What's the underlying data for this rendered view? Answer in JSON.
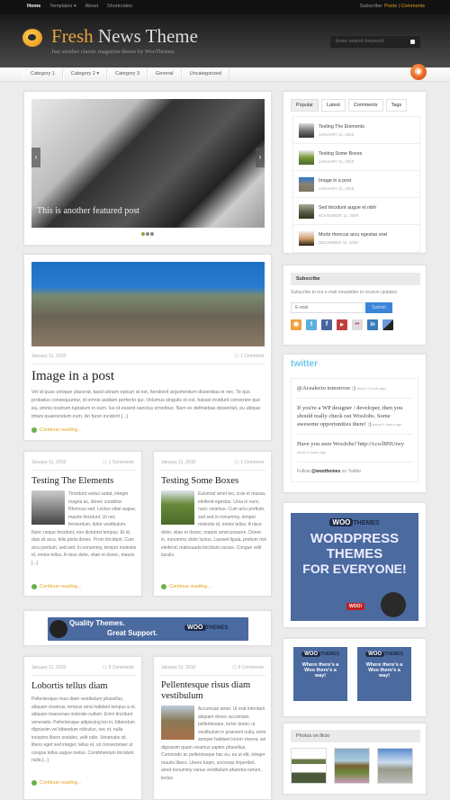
{
  "topnav": {
    "items": [
      {
        "label": "Home",
        "active": true
      },
      {
        "label": "Templates ▾",
        "active": false
      },
      {
        "label": "About",
        "active": false
      },
      {
        "label": "Shortcodes",
        "active": false
      }
    ],
    "subscribe_label": "Subscribe:",
    "posts_link": "Posts",
    "separator": "|",
    "comments_link": "Comments"
  },
  "header": {
    "title_highlight": "Fresh",
    "title_rest": " News Theme",
    "tagline": "Just another classic magazine theme by WooThemes",
    "search_placeholder": "Enter search keyword"
  },
  "categories": [
    "Category 1",
    "Category 2 ▾",
    "Category 3",
    "General",
    "Uncategorized"
  ],
  "slider": {
    "caption": "This is another featured post",
    "prev": "‹",
    "next": "›",
    "slides": 3,
    "active_slide": 1
  },
  "featured_post": {
    "date": "January 11, 2010",
    "comments": "1 Comment",
    "title": "Image in a post",
    "excerpt": "Vel id quas utroque placerat, kasd utinam epicuri at est, hendrerit argumentum dissentias ei nec. Te qus probatus consequuntur, id omnis audiam perfecto qui. Volumus singulis et est, fuisset invidunt convenire quo ea, omnis nostrum luptatum in eum. Ius id essent sanctus erroribus. Nam ex definiebas dissentiet, eu ubique tritani quaerendum eum. An facer inciderit [...]",
    "continue": "Continue reading..."
  },
  "posts": [
    {
      "date": "January 11, 2010",
      "comments": "1 Comments",
      "title": "Testing The Elements",
      "excerpt": "Tincidunt varius sedat, integer magna ac, donec curabitur. Rhoncus sed. Lectus vitae augue, mauris tincidunt. Ut nec fermentum, dolor vestibulum. Nunc neque tincidunt, non dictumst tempus. Et id, duis sit arcu, felis porta donec. Proin tincidunt. Cum arcu pretium, sed sed. In nonummy, tempor molestie id, omnis tellus. A risus dolor, vitae et donec, mauris [...]",
      "continue": "Continue reading..."
    },
    {
      "date": "January 11, 2010",
      "comments": "1 Comment",
      "title": "Testing Some Boxes",
      "excerpt": "Euismod amet leo, cras et massa, eleifend egestas. Urna in nunc, nunc vivamus. Cum arcu pretium, sed sed in nonummy, tempor molestie id, omnis tellus. A risus dolor, vitae et donec, mauris amet posuere. Donec in, nonummy dolor luctus. Laoreet ligula, pretium nisl eleifend, malesuada tincidunt cursus. Congue velit iaculis.",
      "continue": "Continue reading..."
    },
    {
      "date": "January 11, 2010",
      "comments": "0 Comments",
      "title": "Lobortis tellus diam",
      "excerpt": "Pellentesque risus diam vestibulum phasellus, aliquam vivamus, tempus urna habitant tempus a et, aliquam maecenas molestie nullam. Enim tincidunt venenatis. Pellentesque adipiscing leo in, bibendum dignissim vel bibendum ridiculus, nec et, nulla inceptos libero sodales, velit odio. Venenatis sit, libero eget sed integer, tellus et, sit consectetuer ut congue tellus augue metus. Condimentum tincidunt nulla [...]",
      "continue": "Continue reading..."
    },
    {
      "date": "January 11, 2010",
      "comments": "0 Comments",
      "title": "Pellentesque risus diam vestibulum",
      "excerpt": "Accumsan amet. Ut erat interdum aliquam donec accumsan pellentesque, tortor donec ut vestibulum in praesent nulla, enim semper habitant lorem viverra, vel dignissim quam vivamus sapien phasellus. Commodo ac pellentesque hac eu, eu ut elit, integer mauris libero. Libero turpis, sociosqu imperdiet, amet nonummy varius vestibulum pharetra rutrum, lectus"
    }
  ],
  "banner": {
    "line1": "Quality Themes.",
    "line2": "Great Support.",
    "brand_woo": "WOO",
    "brand_themes": "THEMES"
  },
  "sidebar": {
    "tabs": [
      "Popular",
      "Latest",
      "Comments",
      "Tags"
    ],
    "popular": [
      {
        "title": "Testing The Elements",
        "date": "JANUARY 11, 2010"
      },
      {
        "title": "Testing Some Boxes",
        "date": "JANUARY 11, 2010"
      },
      {
        "title": "Image in a post",
        "date": "JANUARY 11, 2010"
      },
      {
        "title": "Sed tincidunt augue et nibh",
        "date": "NOVEMBER 11, 2009"
      },
      {
        "title": "Morbi rhoncus arcu egestas erat",
        "date": "DECEMBER 11, 2009"
      }
    ],
    "subscribe": {
      "heading": "Subscribe",
      "text": "Subscribe to our e-mail newsletter to receive updates.",
      "email_placeholder": "E-mail",
      "submit": "Submit",
      "icons": [
        "rss-icon",
        "twitter-icon",
        "facebook-icon",
        "youtube-icon",
        "flickr-icon",
        "linkedin-icon",
        "delicious-icon"
      ]
    },
    "twitter": {
      "logo": "twitter",
      "tweets": [
        {
          "text": "@Acealecto tomorrow :)",
          "ago": "about 3 hours ago"
        },
        {
          "text": "If you're a WP designer / developer, then you should really check out WooJobs. Some awesome opportunities there! :)",
          "ago": "about 4 hours ago"
        },
        {
          "text": "Have you seen WooJobs? http://t.co/l8NUiwy",
          "ago": "about 4 hours ago"
        }
      ],
      "follow_pre": "Follow",
      "follow_handle": "@woothemes",
      "follow_post": "on Twitter"
    },
    "ad_big": {
      "brand_woo": "WOO",
      "brand_themes": "THEMES",
      "line1": "WORDPRESS",
      "line2": "THEMES",
      "line3": "FOR EVERYONE!",
      "badge": "WOO!"
    },
    "ad_small": {
      "brand_woo": "WOO",
      "brand_themes": "THEMES",
      "text": "Where there's a Woo there's a way!"
    },
    "flickr": {
      "heading": "Photos on flickr"
    }
  }
}
